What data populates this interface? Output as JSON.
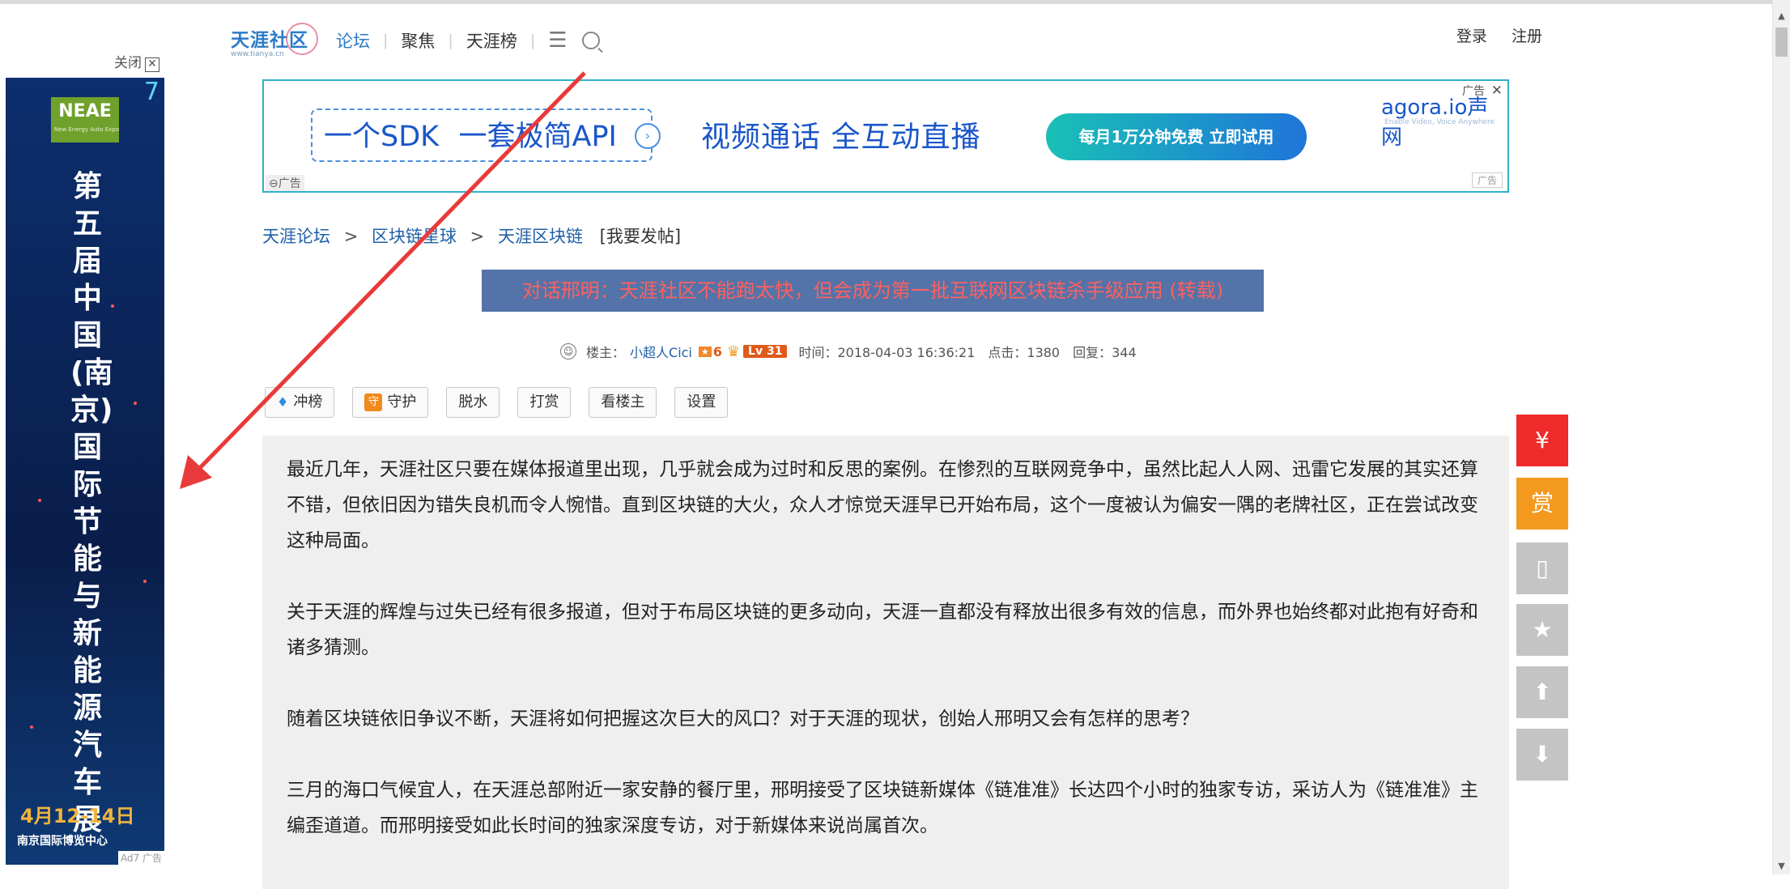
{
  "header": {
    "logo_text": "天涯社区",
    "logo_sub": "www.tianya.cn",
    "nav": [
      "论坛",
      "聚焦",
      "天涯榜"
    ],
    "login": "登录",
    "register": "注册"
  },
  "banner_ad": {
    "sdk_text": "一个SDK",
    "api_text": "一套极简API",
    "mid_text": "视频通话   全互动直播",
    "cta": "每月1万分钟免费  立即试用",
    "brand": "agora.io声网",
    "brand_sub": "Enable Video, Voice Anywhere",
    "ad_label": "广告",
    "ad_label_bottom": "广告",
    "ad_label_left": "广告"
  },
  "breadcrumb": {
    "items": [
      "天涯论坛",
      "区块链星球",
      "天涯区块链"
    ],
    "post_link": "[我要发帖]"
  },
  "post": {
    "title": "对话邢明：天涯社区不能跑太快，但会成为第一批互联网区块链杀手级应用 (转载)",
    "author_label": "楼主：",
    "author": "小超人Cici",
    "badge_num": "6",
    "level": "Lv 31",
    "time": "时间：2018-04-03 16:36:21",
    "clicks": "点击：1380",
    "replies": "回复：344"
  },
  "actions": [
    "冲榜",
    "守护",
    "脱水",
    "打赏",
    "看楼主",
    "设置"
  ],
  "paragraphs": [
    "最近几年，天涯社区只要在媒体报道里出现，几乎就会成为过时和反思的案例。在惨烈的互联网竞争中，虽然比起人人网、迅雷它发展的其实还算不错，但依旧因为错失良机而令人惋惜。直到区块链的大火，众人才惊觉天涯早已开始布局，这个一度被认为偏安一隅的老牌社区，正在尝试改变这种局面。",
    "关于天涯的辉煌与过失已经有很多报道，但对于布局区块链的更多动向，天涯一直都没有释放出很多有效的信息，而外界也始终都对此抱有好奇和诸多猜测。",
    "随着区块链依旧争议不断，天涯将如何把握这次巨大的风口？对于天涯的现状，创始人邢明又会有怎样的思考？",
    "三月的海口气候宜人，在天涯总部附近一家安静的餐厅里，邢明接受了区块链新媒体《链准准》长达四个小时的独家专访，采访人为《链准准》主编歪道道。而邢明接受如此长时间的独家深度专访，对于新媒体来说尚属首次。"
  ],
  "side_ad": {
    "close": "关闭",
    "logo": "NEAE",
    "logo_sub": "New Energy Auto Expo",
    "corner": "7",
    "title": "第五届中国(南京)国际节能与新能源汽车展",
    "date": "4月12-14日",
    "venue": "南京国际博览中心",
    "tag": "Ad7 广告"
  },
  "colors": {
    "accent": "#2b7bc7",
    "title_bg": "#5473a8",
    "title_text": "#ff6060",
    "red_button": "#ef2b2b",
    "orange_button": "#f39a1e"
  }
}
